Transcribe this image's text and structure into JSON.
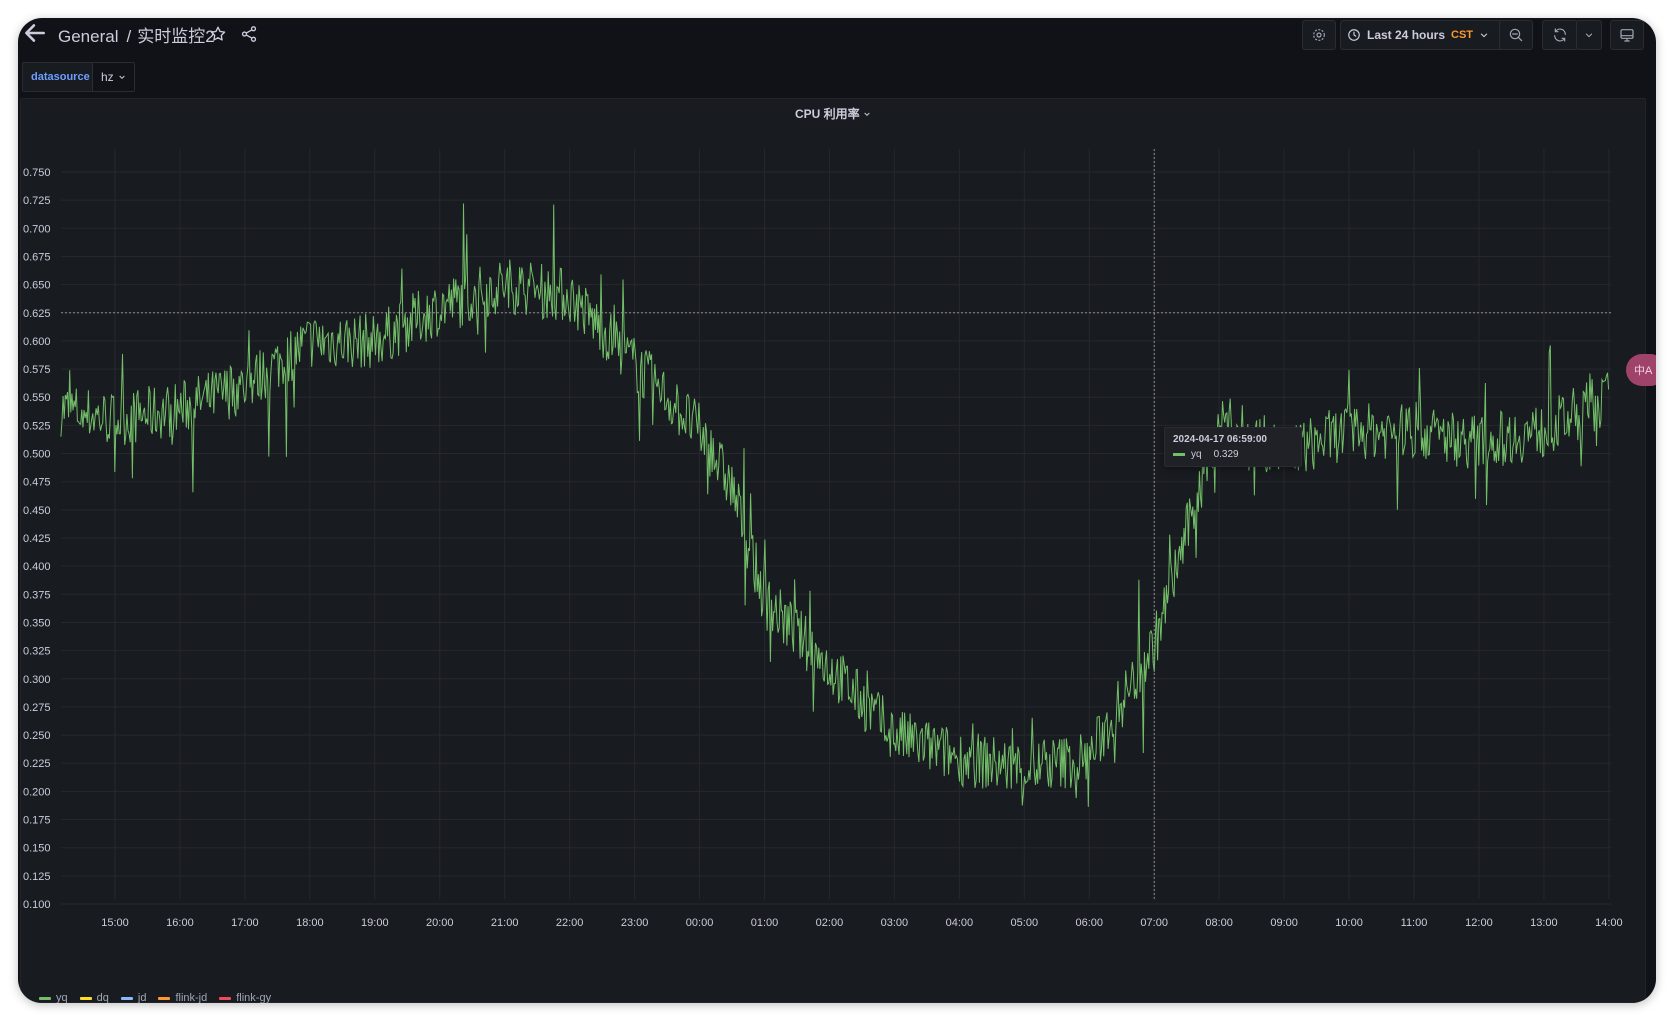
{
  "header": {
    "folder": "General",
    "separator": "/",
    "dashboard_title": "实时监控2"
  },
  "toolbar": {
    "time_range_label": "Last 24 hours",
    "timezone": "CST",
    "icons": [
      "settings-icon",
      "clock-icon",
      "zoom-out-icon",
      "refresh-icon",
      "chevron-down-icon",
      "tv-mode-icon",
      "star-icon",
      "share-icon",
      "back-arrow-icon"
    ]
  },
  "variables": {
    "label": "datasource",
    "value": "hz"
  },
  "panel": {
    "title": "CPU 利用率"
  },
  "tooltip": {
    "time": "2024-04-17 06:59:00",
    "series": "yq",
    "value": "0.329"
  },
  "side_badge": "中A",
  "colors": {
    "yq": "#73bf69",
    "dq": "#fade2a",
    "jd": "#8ab8ff",
    "flink-jd": "#ff9830",
    "flink-gy": "#f2495c",
    "background": "#111217",
    "panel": "#181b1f"
  },
  "chart_data": {
    "type": "line",
    "title": "CPU 利用率",
    "xlabel": "",
    "ylabel": "",
    "ylim": [
      0.1,
      0.75
    ],
    "y_ticks": [
      "0.750",
      "0.725",
      "0.700",
      "0.675",
      "0.650",
      "0.625",
      "0.600",
      "0.575",
      "0.550",
      "0.525",
      "0.500",
      "0.475",
      "0.450",
      "0.425",
      "0.400",
      "0.375",
      "0.350",
      "0.325",
      "0.300",
      "0.275",
      "0.250",
      "0.225",
      "0.200",
      "0.175",
      "0.150",
      "0.125",
      "0.100"
    ],
    "x_ticks": [
      "15:00",
      "16:00",
      "17:00",
      "18:00",
      "19:00",
      "20:00",
      "21:00",
      "22:00",
      "23:00",
      "00:00",
      "01:00",
      "02:00",
      "03:00",
      "04:00",
      "05:00",
      "06:00",
      "07:00",
      "08:00",
      "09:00",
      "10:00",
      "11:00",
      "12:00",
      "13:00",
      "14:00"
    ],
    "grid": true,
    "legend_position": "bottom-left",
    "crosshair": {
      "x": "07:00",
      "y": 0.625
    },
    "series": [
      {
        "name": "yq",
        "x": [
          "14:10",
          "15:00",
          "16:00",
          "17:00",
          "18:00",
          "19:00",
          "20:00",
          "21:00",
          "22:00",
          "23:00",
          "00:00",
          "00:30",
          "01:00",
          "02:00",
          "03:00",
          "04:00",
          "05:00",
          "06:00",
          "07:00",
          "07:30",
          "08:00",
          "09:00",
          "10:00",
          "11:00",
          "12:00",
          "13:00",
          "14:00"
        ],
        "values": [
          0.54,
          0.53,
          0.54,
          0.56,
          0.6,
          0.6,
          0.63,
          0.65,
          0.64,
          0.58,
          0.52,
          0.47,
          0.37,
          0.31,
          0.25,
          0.23,
          0.22,
          0.23,
          0.33,
          0.43,
          0.53,
          0.5,
          0.52,
          0.52,
          0.51,
          0.52,
          0.55
        ]
      },
      {
        "name": "dq",
        "x": [],
        "values": []
      },
      {
        "name": "jd",
        "x": [],
        "values": []
      },
      {
        "name": "flink-jd",
        "x": [],
        "values": []
      },
      {
        "name": "flink-gy",
        "x": [],
        "values": []
      }
    ]
  }
}
